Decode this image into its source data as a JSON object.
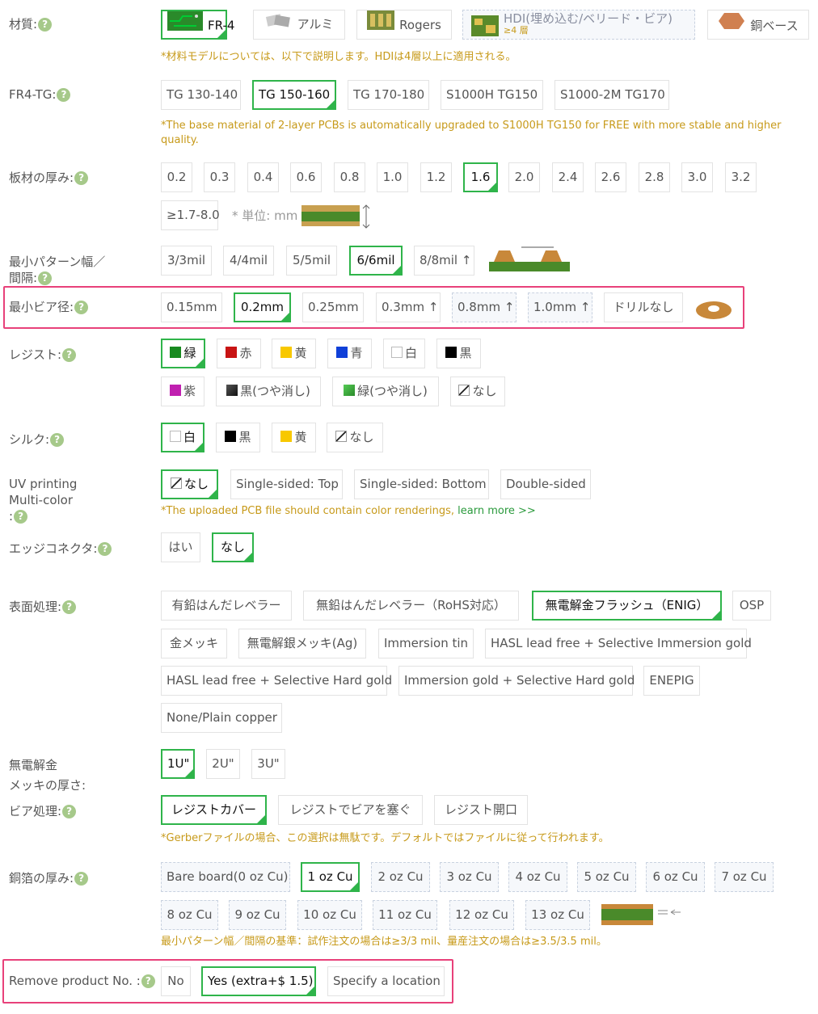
{
  "material": {
    "label": "材質:",
    "options": [
      "FR-4",
      "アルミ",
      "Rogers",
      "HDI(埋め込む/ベリード・ビア)",
      "銅ベース"
    ],
    "hdi_sub": "≥4 層",
    "note": "*材料モデルについては、以下で説明します。HDIは4層以上に適用される。"
  },
  "tg": {
    "label": "FR4-TG:",
    "options": [
      "TG 130-140",
      "TG 150-160",
      "TG 170-180",
      "S1000H TG150",
      "S1000-2M TG170"
    ],
    "note": "*The base material of 2-layer PCBs is automatically upgraded to S1000H TG150 for FREE with more stable and higher quality."
  },
  "thickness": {
    "label": "板材の厚み:",
    "options": [
      "0.2",
      "0.3",
      "0.4",
      "0.6",
      "0.8",
      "1.0",
      "1.2",
      "1.6",
      "2.0",
      "2.4",
      "2.6",
      "2.8",
      "3.0",
      "3.2"
    ],
    "extra": "≥1.7-8.0",
    "unit": "* 単位: mm"
  },
  "trace": {
    "label1": "最小パターン幅／",
    "label2": "間隔:",
    "options": [
      "3/3mil",
      "4/4mil",
      "5/5mil",
      "6/6mil",
      "8/8mil ↑"
    ]
  },
  "via": {
    "label": "最小ビア径:",
    "options": [
      "0.15mm",
      "0.2mm",
      "0.25mm",
      "0.3mm ↑",
      "0.8mm ↑",
      "1.0mm ↑",
      "ドリルなし"
    ]
  },
  "resist": {
    "label": "レジスト:",
    "options": [
      "緑",
      "赤",
      "黄",
      "青",
      "白",
      "黒",
      "紫",
      "黒(つや消し)",
      "緑(つや消し)",
      "なし"
    ]
  },
  "silk": {
    "label": "シルク:",
    "options": [
      "白",
      "黒",
      "黄",
      "なし"
    ]
  },
  "uv": {
    "label1": "UV printing",
    "label2": "Multi-color",
    "label3": ":",
    "options": [
      "なし",
      "Single-sided: Top",
      "Single-sided: Bottom",
      "Double-sided"
    ],
    "note": "*The uploaded PCB file should contain color renderings,",
    "link": "learn more >>"
  },
  "edge": {
    "label": "エッジコネクタ:",
    "options": [
      "はい",
      "なし"
    ]
  },
  "surface": {
    "label": "表面処理:",
    "options": [
      "有鉛はんだレベラー",
      "無鉛はんだレベラー（RoHS対応）",
      "無電解金フラッシュ（ENIG）",
      "OSP",
      "金メッキ",
      "無電解銀メッキ(Ag)",
      "Immersion tin",
      "HASL lead free + Selective Immersion gold",
      "HASL lead free + Selective Hard gold",
      "Immersion gold + Selective Hard gold",
      "ENEPIG",
      "None/Plain copper"
    ]
  },
  "gold": {
    "label1": "無電解金",
    "label2": "メッキの厚さ:",
    "options": [
      "1U\"",
      "2U\"",
      "3U\""
    ]
  },
  "viaproc": {
    "label": "ビア処理:",
    "options": [
      "レジストカバー",
      "レジストでビアを塞ぐ",
      "レジスト開口"
    ],
    "note": "*Gerberファイルの場合、この選択は無駄です。デフォルトではファイルに従って行われます。"
  },
  "copper": {
    "label": "銅箔の厚み:",
    "options": [
      "Bare board(0 oz Cu)",
      "1 oz Cu",
      "2 oz Cu",
      "3 oz Cu",
      "4 oz Cu",
      "5 oz Cu",
      "6 oz Cu",
      "7 oz Cu",
      "8 oz Cu",
      "9 oz Cu",
      "10 oz Cu",
      "11 oz Cu",
      "12 oz Cu",
      "13 oz Cu"
    ],
    "note": "最小パターン幅／間隔の基準：試作注文の場合は≥3/3 mil、量産注文の場合は≥3.5/3.5 mil。"
  },
  "remove": {
    "label": "Remove product No. :",
    "options": [
      "No",
      "Yes (extra+$ 1.5)",
      "Specify a location"
    ]
  },
  "help_glyph": "?",
  "colors": {
    "accent": "#2fb44a",
    "highlight": "#e8417a",
    "note": "#c79a1a"
  }
}
